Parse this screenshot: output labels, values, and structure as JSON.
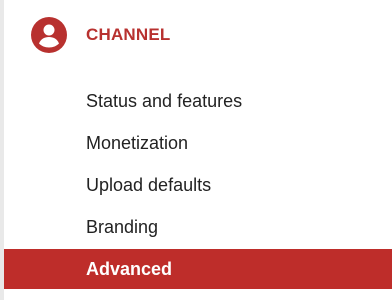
{
  "colors": {
    "accent": "#b8312f",
    "active_bg": "#be2d2a",
    "active_text": "#ffffff",
    "text": "#222222"
  },
  "section": {
    "icon": "account-circle-icon",
    "title": "CHANNEL"
  },
  "nav": {
    "items": [
      {
        "label": "Status and features",
        "active": false
      },
      {
        "label": "Monetization",
        "active": false
      },
      {
        "label": "Upload defaults",
        "active": false
      },
      {
        "label": "Branding",
        "active": false
      },
      {
        "label": "Advanced",
        "active": true
      }
    ]
  }
}
